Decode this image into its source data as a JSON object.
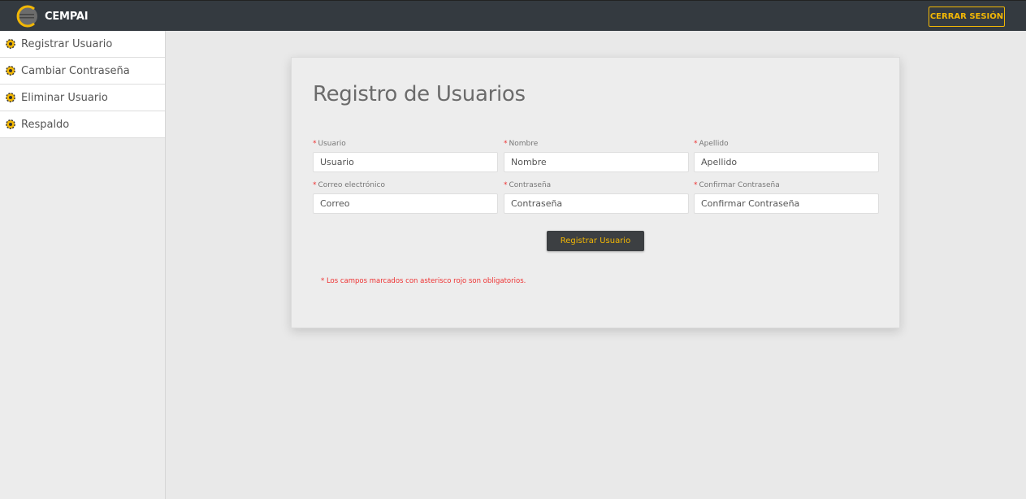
{
  "header": {
    "brand": "CEMPAI",
    "logout_label": "CERRAR SESIÓN"
  },
  "sidebar": {
    "items": [
      {
        "label": "Registrar Usuario",
        "icon": "gear-icon"
      },
      {
        "label": "Cambiar Contraseña",
        "icon": "gear-icon"
      },
      {
        "label": "Eliminar Usuario",
        "icon": "gear-icon"
      },
      {
        "label": "Respaldo",
        "icon": "gear-icon"
      }
    ]
  },
  "form": {
    "title": "Registro de Usuarios",
    "fields": [
      {
        "label": "Usuario",
        "placeholder": "Usuario"
      },
      {
        "label": "Nombre",
        "placeholder": "Nombre"
      },
      {
        "label": "Apellido",
        "placeholder": "Apellido"
      },
      {
        "label": "Correo electrónico",
        "placeholder": "Correo"
      },
      {
        "label": "Contraseña",
        "placeholder": "Contraseña"
      },
      {
        "label": "Confirmar Contraseña",
        "placeholder": "Confirmar Contraseña"
      }
    ],
    "required_mark": "*",
    "submit_label": "Registrar Usuario",
    "note": "* Los campos marcados con asterisco rojo son obligatorios."
  },
  "colors": {
    "topbar": "#343a40",
    "accent": "#f2b705",
    "required": "#e33333",
    "button_bg": "#3c3f42"
  }
}
